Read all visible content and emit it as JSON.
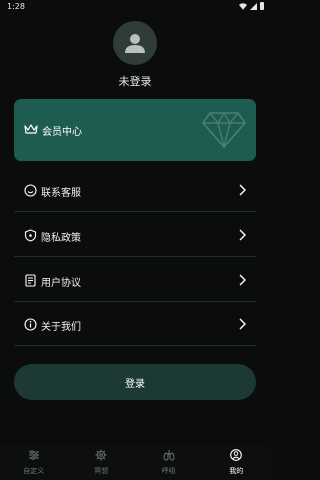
{
  "status_bar": {
    "time": "1:28"
  },
  "profile": {
    "username": "未登录"
  },
  "vip": {
    "label": "会员中心"
  },
  "menu": [
    {
      "label": "联系客服",
      "icon": "smile-icon"
    },
    {
      "label": "隐私政策",
      "icon": "shield-icon"
    },
    {
      "label": "用户协议",
      "icon": "document-icon"
    },
    {
      "label": "关于我们",
      "icon": "info-icon"
    }
  ],
  "login_button": {
    "label": "登录"
  },
  "tabbar": {
    "items": [
      {
        "label": "自定义",
        "icon": "sliders-icon"
      },
      {
        "label": "冥想",
        "icon": "gear-icon"
      },
      {
        "label": "呼吸",
        "icon": "lungs-icon"
      },
      {
        "label": "我的",
        "icon": "user-icon",
        "active": true
      }
    ]
  },
  "colors": {
    "background": "#0b0c0c",
    "vip_card": "#1e5c52",
    "login_button": "#1d3936",
    "avatar": "#2f3c3a"
  }
}
